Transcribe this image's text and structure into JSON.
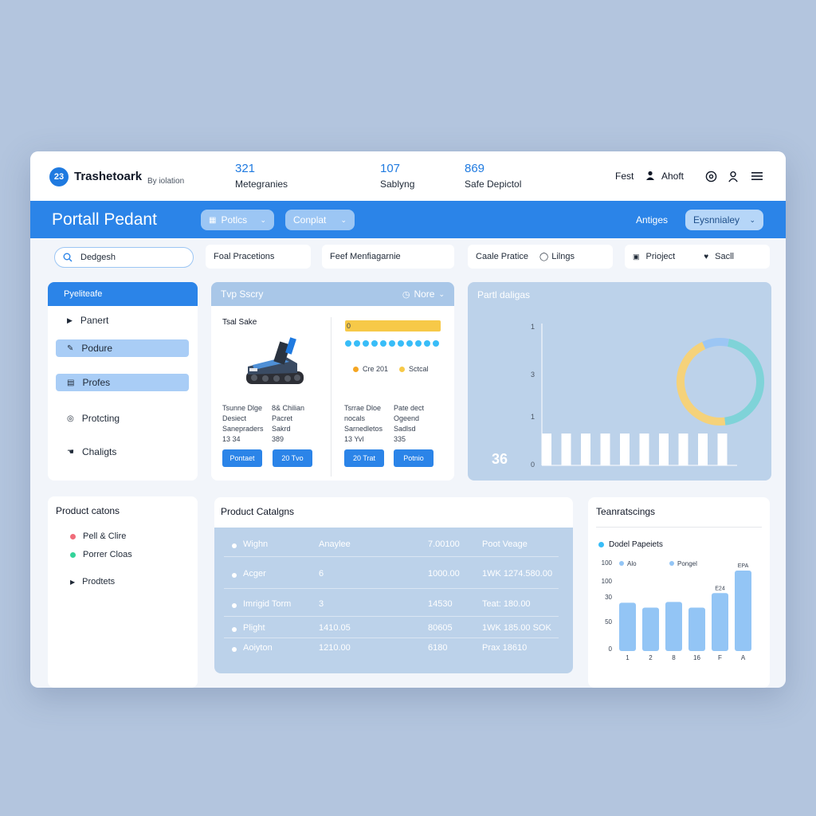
{
  "header": {
    "logo_badge": "23",
    "brand": "Trashetoark",
    "brand_sub": "By iolation",
    "stats": [
      {
        "value": "321",
        "label": "Metegranies"
      },
      {
        "value": "107",
        "label": "Sablyng"
      },
      {
        "value": "869",
        "label": "Safe Depictol"
      }
    ],
    "nav": {
      "fest": "Fest",
      "about": "Ahoft"
    },
    "icons": [
      "gear-icon",
      "user-icon",
      "menu-icon"
    ]
  },
  "bluebar": {
    "title": "Portall Pedant",
    "pill1": "Potlcs",
    "pill2": "Conplat",
    "right_text": "Antiges",
    "right_pill": "Eysnnialey"
  },
  "filters": {
    "search_value": "Dedgesh",
    "f1": "Foal Pracetions",
    "f2": "Feef Menfiagarnie",
    "f3a": "Caale Pratice",
    "f3b": "Lilngs",
    "f4a": "Prioject",
    "f4b": "Sacll"
  },
  "sidebar": {
    "head": "Pyeliteafe",
    "items": [
      {
        "label": "Panert",
        "icon": "triangle-right-icon"
      },
      {
        "label": "Podure",
        "icon": "pencil-icon"
      },
      {
        "label": "Profes",
        "icon": "folder-icon"
      },
      {
        "label": "Protcting",
        "icon": "target-icon"
      },
      {
        "label": "Chaligts",
        "icon": "hand-icon"
      }
    ]
  },
  "top_sorry": {
    "head": "Tvp Sscry",
    "head_right": "Nore",
    "product_title": "Tsal Sake",
    "left_text": {
      "c1": [
        "Tsunne Dlge",
        "Desiect",
        "Sanepraders",
        "13 34"
      ],
      "c2": [
        "8& Chilian",
        "Pacret",
        "Sakrd",
        "389"
      ],
      "btn1": "Pontaet",
      "btn2": "20 Tvo"
    },
    "right_text": {
      "c1": [
        "Tsrrae Dloe",
        "nocals",
        "Sarnedletos",
        "13 Yvl"
      ],
      "c2": [
        "Pate dect",
        "Ogeend",
        "Sadlsd",
        "335"
      ],
      "btn1": "20 Trat",
      "btn2": "Potnio"
    },
    "progress_start": "0",
    "progress_fraction": 1.0,
    "dots_count": 11,
    "legend": [
      {
        "label": "Cre 201",
        "color": "#f5a623"
      },
      {
        "label": "Sctcal",
        "color": "#f7c948"
      }
    ]
  },
  "partial": {
    "head": "Partl daligas",
    "big_number": "36",
    "y_ticks": [
      "1",
      "3",
      "1",
      "0"
    ],
    "donut": {
      "segments": [
        {
          "value": 45,
          "color": "#7fd3d8"
        },
        {
          "value": 45,
          "color": "#f5d27a"
        },
        {
          "value": 10,
          "color": "#9cc6f4"
        }
      ]
    },
    "bars_count": 10
  },
  "product_cations": {
    "head": "Product catons",
    "items": [
      {
        "label": "Pell & Clire",
        "color": "#f06c7a"
      },
      {
        "label": "Porrer Cloas",
        "color": "#34d399"
      },
      {
        "label": "Prodtets",
        "color": "#111827"
      }
    ]
  },
  "catalogs": {
    "head": "Product Catalgns",
    "rows": [
      [
        "Wighn",
        "Anaylee",
        "7.00100",
        "Poot Veage"
      ],
      [
        "Acger",
        "6",
        "1000.00",
        "1WK 1274.580.00"
      ],
      [
        "Imrigid Torm",
        "3",
        "14530",
        "Teat: 180.00"
      ],
      [
        "Plight",
        "1410.05",
        "80605",
        "1WK 185.00 SOK"
      ],
      [
        "Aoiyton",
        "1210.00",
        "6180",
        "Prax 18610"
      ]
    ]
  },
  "tech": {
    "head": "Teanratscings",
    "legend_title": "Dodel Papeiets",
    "legend": [
      "Alo",
      "Pongel"
    ],
    "y_ticks": [
      "100",
      "30",
      "50",
      "0"
    ],
    "top_tick": "100"
  },
  "chart_data": {
    "type": "bar",
    "categories": [
      "1",
      "2",
      "8",
      "16",
      "F",
      "A"
    ],
    "values": [
      60,
      54,
      61,
      54,
      72,
      100
    ],
    "data_labels": [
      "",
      "",
      "",
      "",
      "E24",
      "EPA"
    ],
    "y_tick_labels": [
      "100",
      "100",
      "30",
      "50",
      "0"
    ],
    "legend": [
      "Alo",
      "Pongel"
    ],
    "ylim": [
      0,
      100
    ],
    "color": "#93c5f5"
  }
}
